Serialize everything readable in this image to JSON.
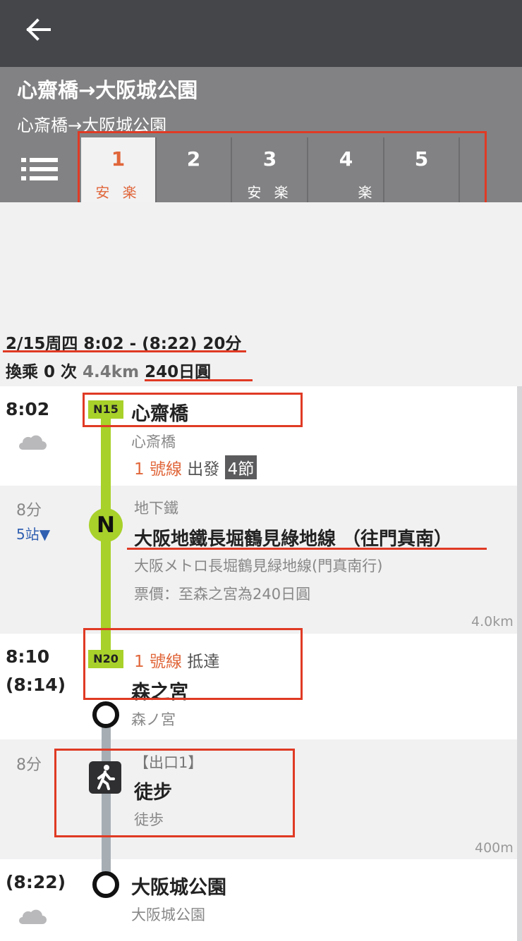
{
  "header": {
    "title": "心齋橋→大阪城公園",
    "subtitle": "心斎橋→大阪城公園"
  },
  "tabs": [
    {
      "label": "1",
      "sub": "安 楽",
      "active": true
    },
    {
      "label": "2",
      "sub": ""
    },
    {
      "label": "3",
      "sub": "安 楽"
    },
    {
      "label": "4",
      "sub": "楽"
    },
    {
      "label": "5",
      "sub": ""
    }
  ],
  "summary": {
    "datetime": "2/15周四 8:02 - (8:22) 20分",
    "transfer": "換乘 0 次",
    "distance": "4.4km",
    "fare": "240日圓"
  },
  "steps": {
    "depart": {
      "time": "8:02",
      "code": "N15",
      "name": "心齋橋",
      "name_jp": "心斎橋",
      "line": "1 號線",
      "action": "出發",
      "cars": "4節"
    },
    "ride": {
      "duration": "8分",
      "stops": "5站▼",
      "mode": "地下鐵",
      "line_icon": "N",
      "line_name": "大阪地鐵長堀鶴見綠地線 （往門真南）",
      "line_name_jp": "大阪メトロ長堀鶴見緑地線(門真南行)",
      "fare_note": "票價：至森之宮為240日圓",
      "distance": "4.0km"
    },
    "arrive": {
      "time": "8:10",
      "time2": "(8:14)",
      "code": "N20",
      "line": "1 號線",
      "action": "抵達",
      "name": "森之宮",
      "name_jp": "森ノ宮"
    },
    "walk": {
      "duration": "8分",
      "exit": "【出口1】",
      "title": "徒步",
      "sub": "徒歩",
      "distance": "400m"
    },
    "dest": {
      "time": "(8:22)",
      "name": "大阪城公園",
      "name_jp": "大阪城公園"
    }
  },
  "colors": {
    "accent": "#e0663a",
    "line_green": "#a8d12a",
    "annotation_red": "#e03a24",
    "header_dark": "#45464a",
    "header_grey": "#828284"
  },
  "icons": {
    "back": "arrow-left-icon",
    "list": "list-icon",
    "weather": "cloud-icon",
    "walk": "walking-person-icon"
  }
}
